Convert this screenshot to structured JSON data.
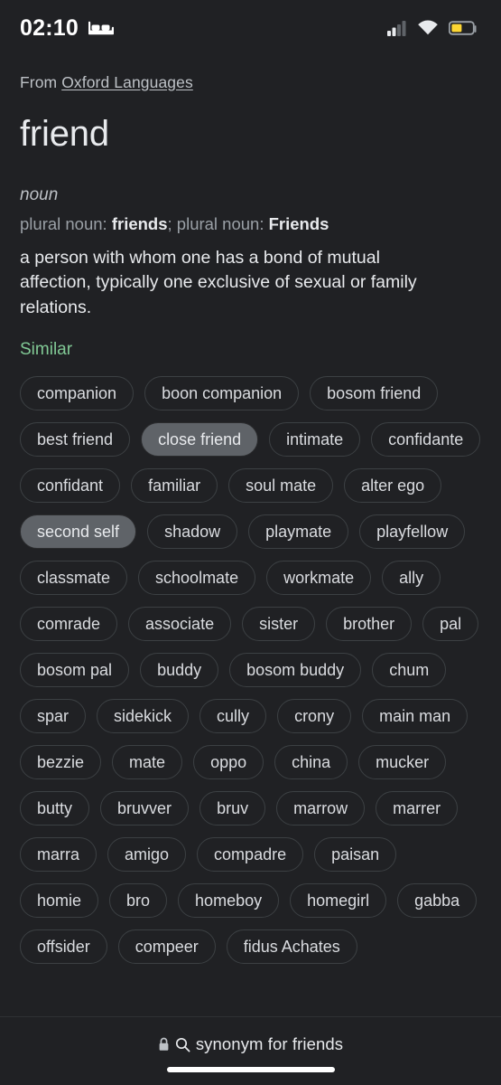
{
  "status_bar": {
    "time": "02:10",
    "bedtime_icon": "bed-icon",
    "signal_icon": "signal-bars-icon",
    "signal_bars_filled": 2,
    "signal_bars_total": 4,
    "wifi_icon": "wifi-icon",
    "battery_icon": "battery-icon",
    "battery_color": "#fdd633",
    "battery_level_percent": 45
  },
  "dictionary": {
    "source_prefix": "From ",
    "source_name": "Oxford Languages",
    "headword": "friend",
    "part_of_speech": "noun",
    "plural_prefix_1": "plural noun: ",
    "plural_1": "friends",
    "plural_separator": "; ",
    "plural_prefix_2": "plural noun: ",
    "plural_2": "Friends",
    "definition": "a person with whom one has a bond of mutual affection, typically one exclusive of sexual or family relations.",
    "similar_label": "Similar",
    "similar_label_color": "#81c995",
    "synonyms": [
      {
        "label": "companion",
        "selected": false
      },
      {
        "label": "boon companion",
        "selected": false
      },
      {
        "label": "bosom friend",
        "selected": false
      },
      {
        "label": "best friend",
        "selected": false
      },
      {
        "label": "close friend",
        "selected": true
      },
      {
        "label": "intimate",
        "selected": false
      },
      {
        "label": "confidante",
        "selected": false
      },
      {
        "label": "confidant",
        "selected": false
      },
      {
        "label": "familiar",
        "selected": false
      },
      {
        "label": "soul mate",
        "selected": false
      },
      {
        "label": "alter ego",
        "selected": false
      },
      {
        "label": "second self",
        "selected": true
      },
      {
        "label": "shadow",
        "selected": false
      },
      {
        "label": "playmate",
        "selected": false
      },
      {
        "label": "playfellow",
        "selected": false
      },
      {
        "label": "classmate",
        "selected": false
      },
      {
        "label": "schoolmate",
        "selected": false
      },
      {
        "label": "workmate",
        "selected": false
      },
      {
        "label": "ally",
        "selected": false
      },
      {
        "label": "comrade",
        "selected": false
      },
      {
        "label": "associate",
        "selected": false
      },
      {
        "label": "sister",
        "selected": false
      },
      {
        "label": "brother",
        "selected": false
      },
      {
        "label": "pal",
        "selected": false
      },
      {
        "label": "bosom pal",
        "selected": false
      },
      {
        "label": "buddy",
        "selected": false
      },
      {
        "label": "bosom buddy",
        "selected": false
      },
      {
        "label": "chum",
        "selected": false
      },
      {
        "label": "spar",
        "selected": false
      },
      {
        "label": "sidekick",
        "selected": false
      },
      {
        "label": "cully",
        "selected": false
      },
      {
        "label": "crony",
        "selected": false
      },
      {
        "label": "main man",
        "selected": false
      },
      {
        "label": "bezzie",
        "selected": false
      },
      {
        "label": "mate",
        "selected": false
      },
      {
        "label": "oppo",
        "selected": false
      },
      {
        "label": "china",
        "selected": false
      },
      {
        "label": "mucker",
        "selected": false
      },
      {
        "label": "butty",
        "selected": false
      },
      {
        "label": "bruvver",
        "selected": false
      },
      {
        "label": "bruv",
        "selected": false
      },
      {
        "label": "marrow",
        "selected": false
      },
      {
        "label": "marrer",
        "selected": false
      },
      {
        "label": "marra",
        "selected": false
      },
      {
        "label": "amigo",
        "selected": false
      },
      {
        "label": "compadre",
        "selected": false
      },
      {
        "label": "paisan",
        "selected": false
      },
      {
        "label": "homie",
        "selected": false
      },
      {
        "label": "bro",
        "selected": false
      },
      {
        "label": "homeboy",
        "selected": false
      },
      {
        "label": "homegirl",
        "selected": false
      },
      {
        "label": "gabba",
        "selected": false
      },
      {
        "label": "offsider",
        "selected": false
      },
      {
        "label": "compeer",
        "selected": false
      },
      {
        "label": "fidus Achates",
        "selected": false
      }
    ]
  },
  "bottom_bar": {
    "lock_icon": "lock-icon",
    "search_icon": "search-icon",
    "query": "synonym for friends"
  }
}
